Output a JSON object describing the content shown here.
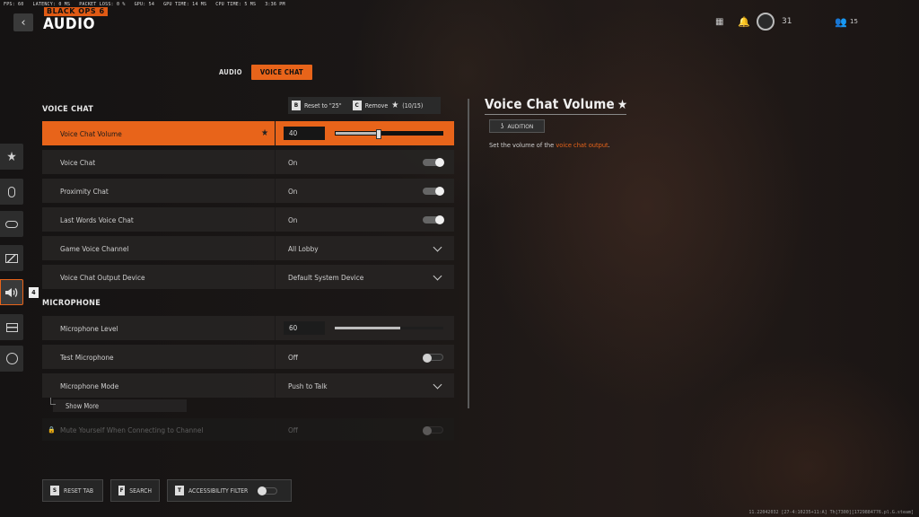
{
  "perf": {
    "items": [
      "FPS: 60",
      "LATENCY: 0 MS",
      "PACKET LOSS: 0 %",
      "GPU: 54",
      "GPU TIME: 14 MS",
      "CPU TIME: 5 MS",
      "3:36 PM"
    ]
  },
  "header": {
    "logo": "BLACK OPS 6",
    "title": "AUDIO",
    "back_icon": "chevron-left-icon",
    "grid_icon": "apps-grid-icon",
    "bell_icon": "bell-icon",
    "prestige_level": "31",
    "friends_count": "15"
  },
  "tabs": [
    {
      "label": "AUDIO",
      "active": false
    },
    {
      "label": "VOICE CHAT",
      "active": true
    }
  ],
  "sidebar": {
    "items": [
      {
        "icon": "star-icon",
        "glyph": "★"
      },
      {
        "icon": "mouse-icon",
        "glyph": "▯"
      },
      {
        "icon": "controller-icon",
        "glyph": "⌂"
      },
      {
        "icon": "graphics-icon",
        "glyph": "◩"
      },
      {
        "icon": "speaker-icon",
        "glyph": "🔊",
        "active": true
      },
      {
        "icon": "interface-icon",
        "glyph": "▤"
      },
      {
        "icon": "network-icon",
        "glyph": "◎"
      }
    ],
    "active_badge": "4"
  },
  "sections": {
    "voice_chat": "VOICE CHAT",
    "microphone": "MICROPHONE"
  },
  "hint_bar": {
    "reset_key": "B",
    "reset_label": "Reset to \"25\"",
    "remove_key": "C",
    "remove_label": "Remove",
    "remove_count": "(10/15)"
  },
  "settings": {
    "voice_chat_volume": {
      "label": "Voice Chat Volume",
      "value": "40",
      "level": 0.4
    },
    "voice_chat": {
      "label": "Voice Chat",
      "value": "On"
    },
    "proximity_chat": {
      "label": "Proximity Chat",
      "value": "On"
    },
    "last_words": {
      "label": "Last Words Voice Chat",
      "value": "On"
    },
    "game_voice_channel": {
      "label": "Game Voice Channel",
      "value": "All Lobby"
    },
    "output_device": {
      "label": "Voice Chat Output Device",
      "value": "Default System Device"
    },
    "mic_level": {
      "label": "Microphone Level",
      "value": "60",
      "level": 0.6
    },
    "test_mic": {
      "label": "Test Microphone",
      "value": "Off"
    },
    "mic_mode": {
      "label": "Microphone Mode",
      "value": "Push to Talk"
    },
    "show_more": "Show More",
    "mute_yourself": {
      "label": "Mute Yourself When Connecting to Channel",
      "value": "Off"
    }
  },
  "detail": {
    "title": "Voice Chat Volume",
    "audition_label": "AUDITION",
    "desc_prefix": "Set the volume of the ",
    "desc_highlight": "voice chat output",
    "desc_suffix": "."
  },
  "bottom": {
    "reset_key": "S",
    "reset_label": "RESET TAB",
    "search_key": "F",
    "search_label": "SEARCH",
    "access_key": "T",
    "access_label": "ACCESSIBILITY FILTER"
  },
  "build_info": "11.22042032 [27-4:10235+11:A] Th[7300][1729884776.pl.G.steam]",
  "colors": {
    "accent": "#e8641a"
  }
}
